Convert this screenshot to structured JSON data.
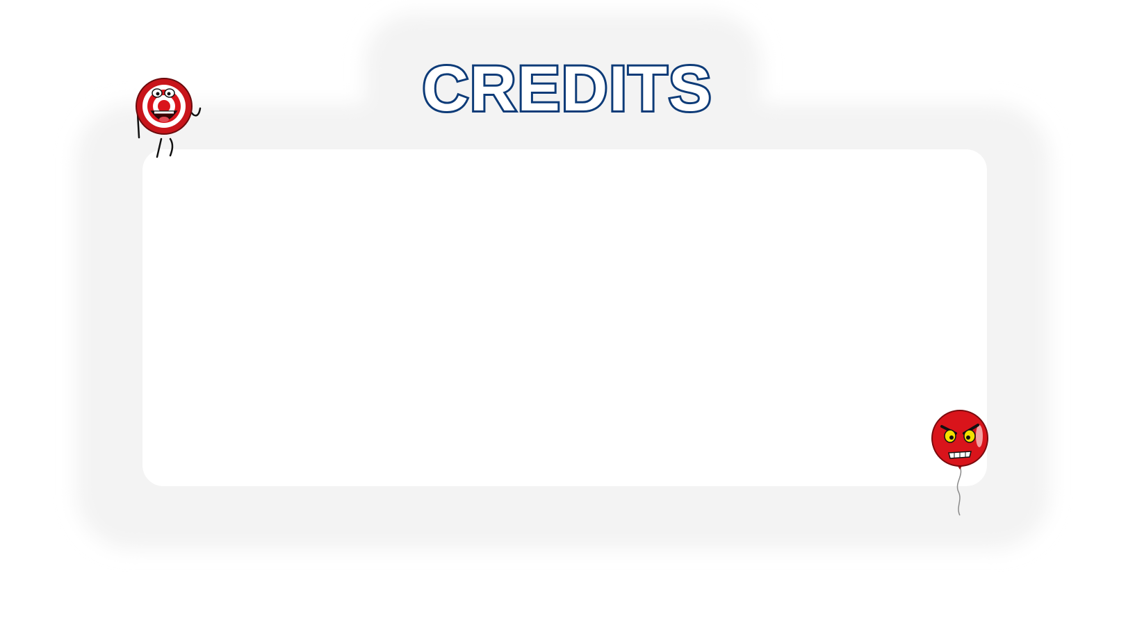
{
  "screen": {
    "title": "CREDITS"
  },
  "colors": {
    "title_outline": "#0d3b78",
    "title_fill": "#ffffff",
    "panel": "#f6f6f6",
    "character_red": "#d9141b"
  },
  "characters": [
    {
      "name": "target-character",
      "icon": "bullseye-target-mascot"
    },
    {
      "name": "angry-balloon-character",
      "icon": "angry-red-balloon"
    }
  ]
}
